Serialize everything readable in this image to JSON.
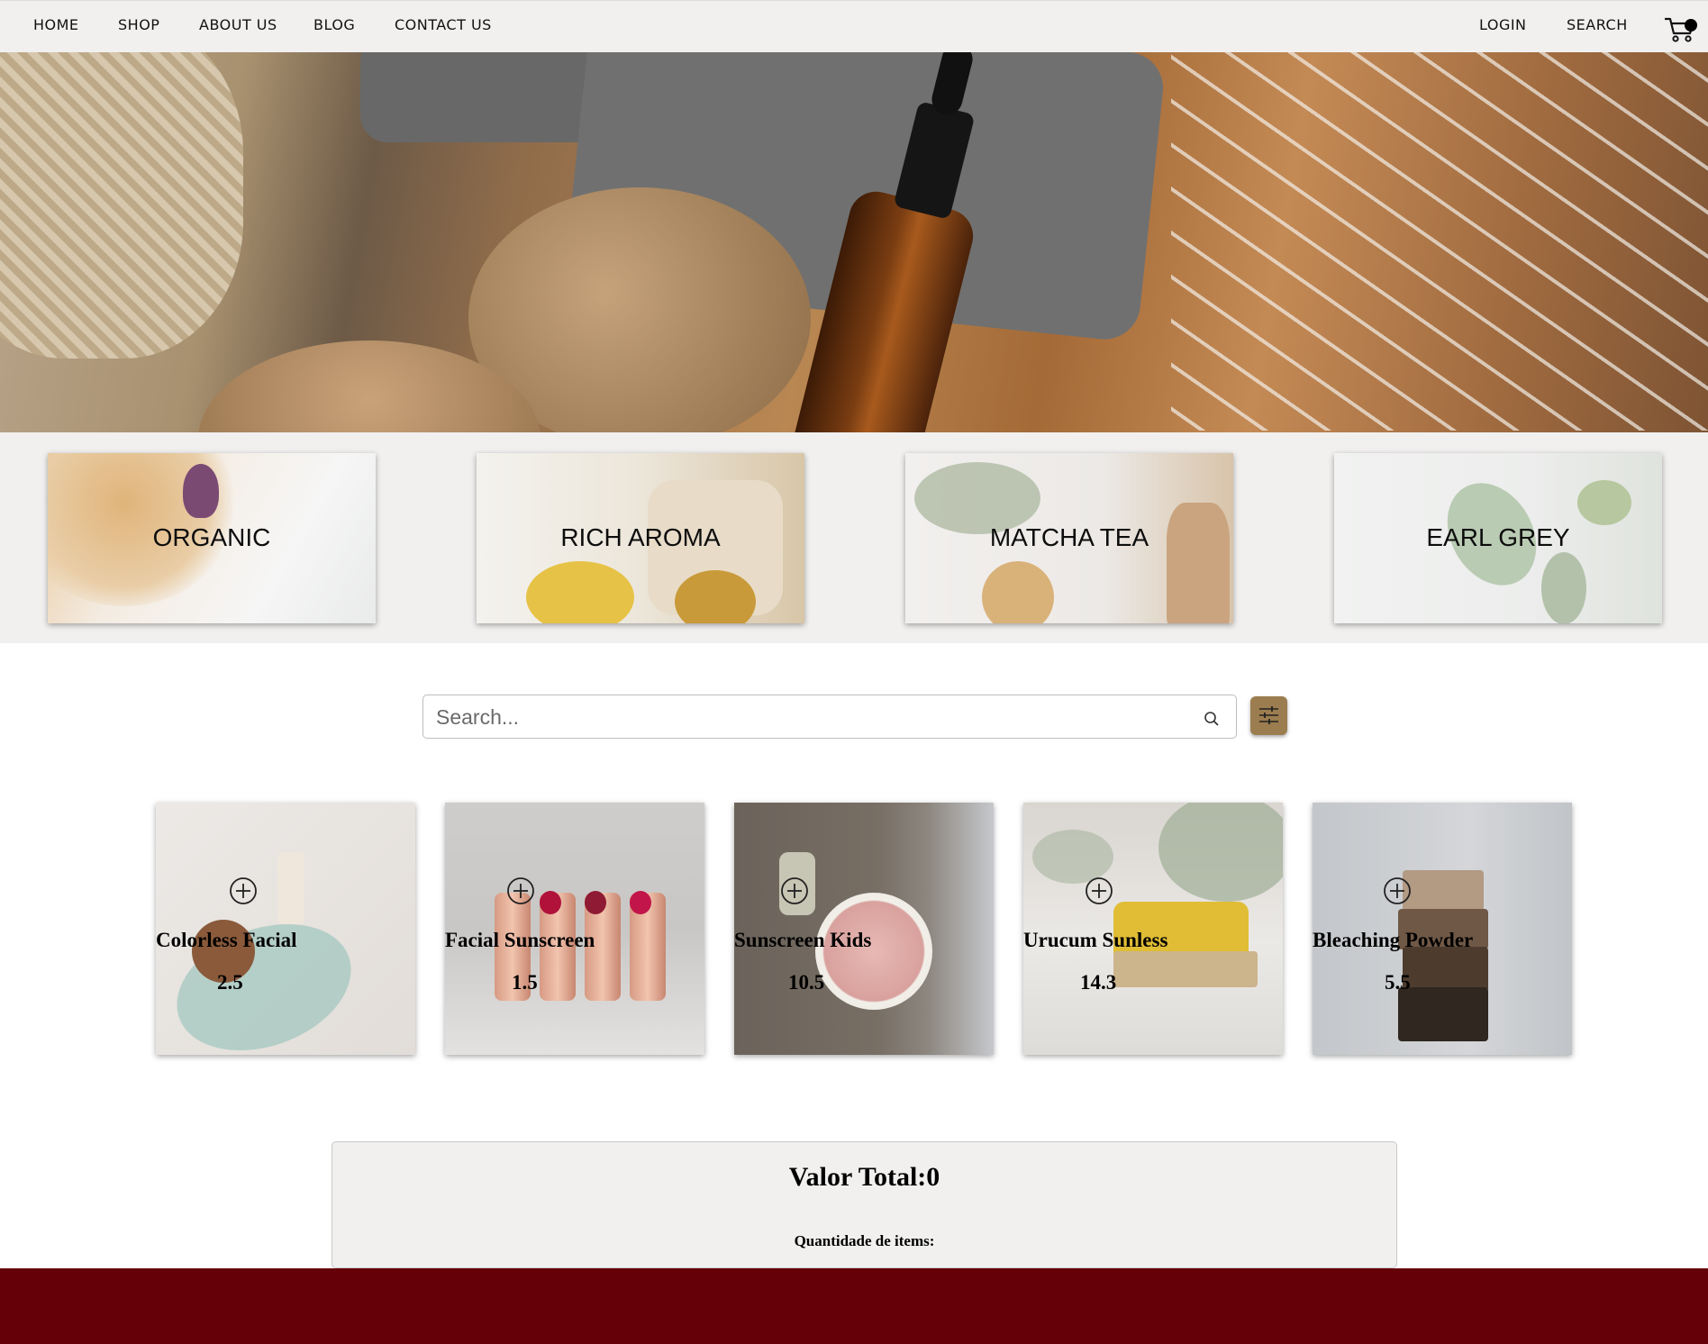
{
  "nav": {
    "left_items": [
      "HOME",
      "SHOP",
      "ABOUT US",
      "BLOG",
      "CONTACT US"
    ],
    "right_items": [
      "LOGIN",
      "SEARCH"
    ],
    "cart_icon": "cart-icon"
  },
  "categories": [
    {
      "label": "ORGANIC"
    },
    {
      "label": "RICH AROMA"
    },
    {
      "label": "MATCHA TEA"
    },
    {
      "label": "EARL GREY"
    }
  ],
  "search": {
    "placeholder": "Search...",
    "icon": "search-icon",
    "filter_icon": "sliders-icon",
    "filter_color": "#9c7d4f"
  },
  "products": [
    {
      "name": "Colorless Facial",
      "price": "2.5",
      "icon": "plus-circle-icon"
    },
    {
      "name": "Facial Sunscreen",
      "price": "1.5",
      "icon": "plus-circle-icon"
    },
    {
      "name": "Sunscreen Kids",
      "price": "10.5",
      "icon": "plus-circle-icon"
    },
    {
      "name": "Urucum Sunless",
      "price": "14.3",
      "icon": "plus-circle-icon"
    },
    {
      "name": "Bleaching Powder",
      "price": "5.5",
      "icon": "plus-circle-icon"
    }
  ],
  "summary": {
    "total_label": "Valor Total:0",
    "quantity_label": "Quantidade de items:"
  },
  "colors": {
    "nav_bg": "#f1f0ef",
    "footer_bg": "#650008",
    "accent": "#9c7d4f"
  }
}
